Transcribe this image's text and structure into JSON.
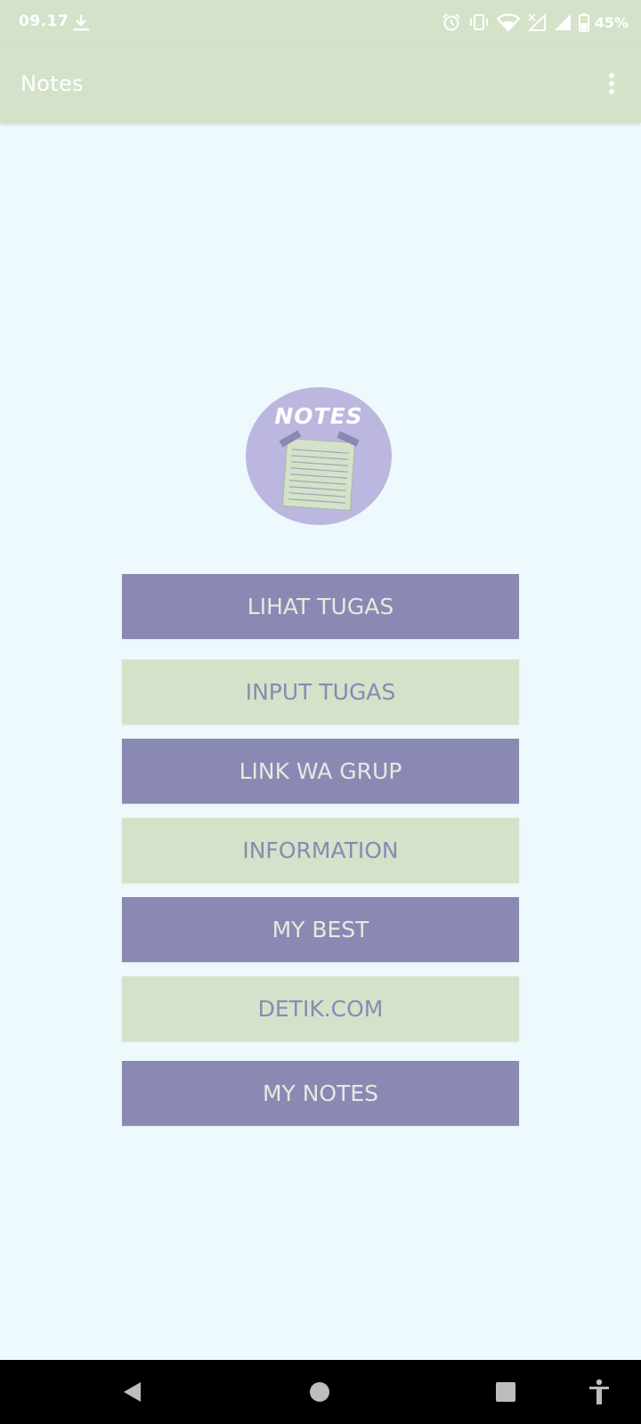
{
  "status_bar": {
    "time": "09.17",
    "battery": "45%",
    "icons": [
      "download-icon",
      "alarm-icon",
      "vibrate-icon",
      "wifi-icon",
      "no-signal-icon",
      "signal-icon",
      "battery-icon"
    ]
  },
  "app_bar": {
    "title": "Notes",
    "overflow_icon": "more-vert-icon"
  },
  "logo": {
    "text": "NOTES",
    "icon": "notepad-icon"
  },
  "menu": {
    "buttons": [
      {
        "label": "LIHAT TUGAS",
        "style": "purple"
      },
      {
        "label": "INPUT TUGAS",
        "style": "green"
      },
      {
        "label": "LINK WA GRUP",
        "style": "purple"
      },
      {
        "label": "INFORMATION",
        "style": "green"
      },
      {
        "label": "MY BEST",
        "style": "purple"
      },
      {
        "label": "DETIK.COM",
        "style": "green"
      },
      {
        "label": "MY NOTES",
        "style": "purple"
      }
    ]
  },
  "nav_bar": {
    "icons": [
      "back-icon",
      "home-icon",
      "recents-icon",
      "accessibility-icon"
    ]
  },
  "colors": {
    "bar_green": "#d4e2c9",
    "button_purple": "#8a89b3",
    "background": "#eef9fd",
    "logo_circle": "#bbb7de"
  }
}
